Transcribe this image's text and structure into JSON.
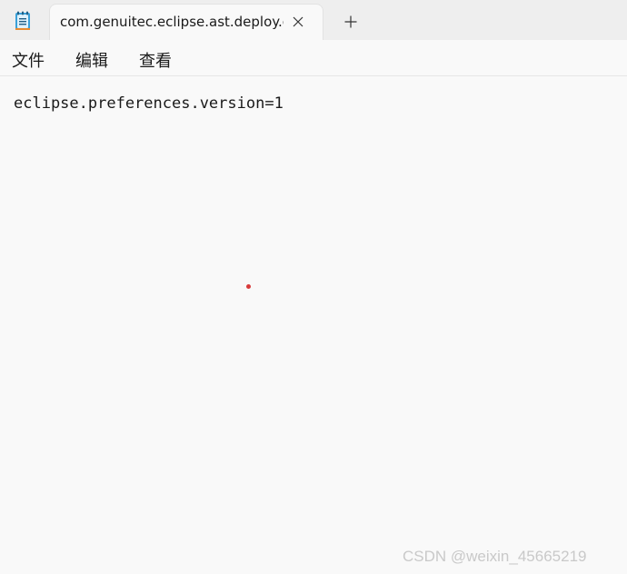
{
  "window": {
    "app_icon": "notepad-icon",
    "tab": {
      "title": "com.genuitec.eclipse.ast.deploy.co",
      "close_icon": "close-icon"
    },
    "new_tab_icon": "plus-icon"
  },
  "menu": {
    "items": [
      {
        "label": "文件"
      },
      {
        "label": "编辑"
      },
      {
        "label": "查看"
      }
    ]
  },
  "editor": {
    "content": "eclipse.preferences.version=1"
  },
  "watermark": "CSDN @weixin_45665219",
  "colors": {
    "titlebar_bg": "#eeeeee",
    "editor_bg": "#f9f9f9",
    "marker": "#d83a3a"
  }
}
